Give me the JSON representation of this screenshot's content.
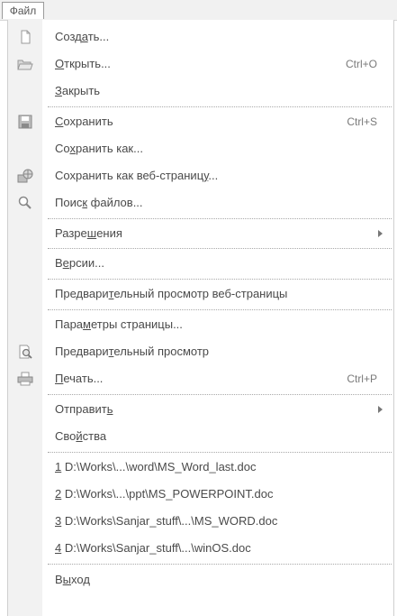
{
  "menubar": {
    "title": "Файл"
  },
  "menu": {
    "items": [
      {
        "pre": "Созд",
        "acc": "а",
        "post": "ть...",
        "shortcut": ""
      },
      {
        "pre": "",
        "acc": "О",
        "post": "ткрыть...",
        "shortcut": "Ctrl+O"
      },
      {
        "pre": "",
        "acc": "З",
        "post": "акрыть",
        "shortcut": ""
      },
      {
        "pre": "",
        "acc": "С",
        "post": "охранить",
        "shortcut": "Ctrl+S"
      },
      {
        "pre": "Со",
        "acc": "х",
        "post": "ранить как...",
        "shortcut": ""
      },
      {
        "pre": "Сохранить как веб-страниц",
        "acc": "у",
        "post": "...",
        "shortcut": ""
      },
      {
        "pre": "Поис",
        "acc": "к",
        "post": " файлов...",
        "shortcut": ""
      },
      {
        "pre": "Разре",
        "acc": "ш",
        "post": "ения",
        "shortcut": ""
      },
      {
        "pre": "В",
        "acc": "е",
        "post": "рсии...",
        "shortcut": ""
      },
      {
        "pre": "Предвари",
        "acc": "т",
        "post": "ельный просмотр веб-страницы",
        "shortcut": ""
      },
      {
        "pre": "Пара",
        "acc": "м",
        "post": "етры страницы...",
        "shortcut": ""
      },
      {
        "pre": "Предвари",
        "acc": "т",
        "post": "ельный просмотр",
        "shortcut": ""
      },
      {
        "pre": "",
        "acc": "П",
        "post": "ечать...",
        "shortcut": "Ctrl+P"
      },
      {
        "pre": "Отправит",
        "acc": "ь",
        "post": "",
        "shortcut": ""
      },
      {
        "pre": "Сво",
        "acc": "й",
        "post": "ства",
        "shortcut": ""
      },
      {
        "pre": "",
        "acc": "1",
        "post": " D:\\Works\\...\\word\\MS_Word_last.doc",
        "shortcut": ""
      },
      {
        "pre": "",
        "acc": "2",
        "post": " D:\\Works\\...\\ppt\\MS_POWERPOINT.doc",
        "shortcut": ""
      },
      {
        "pre": "",
        "acc": "3",
        "post": " D:\\Works\\Sanjar_stuff\\...\\MS_WORD.doc",
        "shortcut": ""
      },
      {
        "pre": "",
        "acc": "4",
        "post": " D:\\Works\\Sanjar_stuff\\...\\winOS.doc",
        "shortcut": ""
      },
      {
        "pre": "В",
        "acc": "ы",
        "post": "ход",
        "shortcut": ""
      }
    ]
  },
  "icons": {
    "new": "new-document-icon",
    "open": "open-folder-icon",
    "save": "save-icon",
    "save_web": "save-as-web-icon",
    "search": "search-files-icon",
    "preview": "print-preview-icon",
    "print": "print-icon"
  },
  "colors": {
    "gutter": "#f2f2f2",
    "text": "#4a4a4a",
    "separator": "#a9a9a9"
  }
}
